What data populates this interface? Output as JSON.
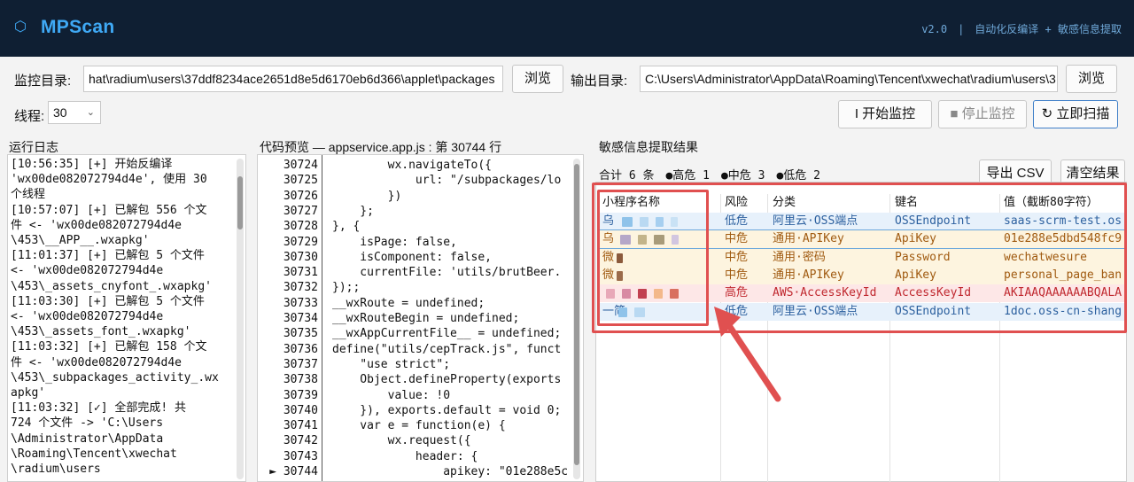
{
  "header": {
    "logo_glyph": "⬡",
    "title": "MPScan",
    "version": "v2.0　|　自动化反编译 + 敏感信息提取"
  },
  "toolbar": {
    "monitor_dir_label": "监控目录:",
    "monitor_dir_value": "hat\\radium\\users\\37ddf8234ace2651d8e5d6170eb6d366\\applet\\packages",
    "browse_label_1": "浏览",
    "output_dir_label": "输出目录:",
    "output_dir_value": "C:\\Users\\Administrator\\AppData\\Roaming\\Tencent\\xwechat\\radium\\users\\3",
    "browse_label_2": "浏览",
    "threads_label": "线程:",
    "threads_value": "30",
    "start_label": "I 开始监控",
    "stop_label": "■ 停止监控",
    "scan_label": "↻ 立即扫描"
  },
  "log": {
    "title": "运行日志",
    "lines": [
      "[10:56:35] [+] 开始反编译",
      "'wx00de082072794d4e', 使用 30",
      "个线程",
      "[10:57:07] [+] 已解包 556 个文",
      "件 <- 'wx00de082072794d4e",
      "\\453\\__APP__.wxapkg'",
      "[11:01:37] [+] 已解包 5 个文件",
      "<- 'wx00de082072794d4e",
      "\\453\\_assets_cnyfont_.wxapkg'",
      "[11:03:30] [+] 已解包 5 个文件",
      "<- 'wx00de082072794d4e",
      "\\453\\_assets_font_.wxapkg'",
      "[11:03:32] [+] 已解包 158 个文",
      "件 <- 'wx00de082072794d4e",
      "\\453\\_subpackages_activity_.wx",
      "apkg'",
      "[11:03:32] [✓] 全部完成! 共",
      "724 个文件 -> 'C:\\Users",
      "\\Administrator\\AppData",
      "\\Roaming\\Tencent\\xwechat",
      "\\radium\\users"
    ]
  },
  "code": {
    "title": "代码预览 — appservice.app.js : 第 30744 行",
    "numbers": [
      "30724",
      "30725",
      "30726",
      "30727",
      "30728",
      "30729",
      "30730",
      "30731",
      "30732",
      "30733",
      "30734",
      "30735",
      "30736",
      "30737",
      "30738",
      "30739",
      "30740",
      "30741",
      "30742",
      "30743",
      "► 30744"
    ],
    "lines": [
      "        wx.navigateTo({",
      "            url: \"/subpackages/lo",
      "        })",
      "    };",
      "}, {",
      "    isPage: false,",
      "    isComponent: false,",
      "    currentFile: 'utils/brutBeer.",
      "});;",
      "__wxRoute = undefined;",
      "__wxRouteBegin = undefined;",
      "__wxAppCurrentFile__ = undefined;",
      "define(\"utils/cepTrack.js\", funct",
      "    \"use strict\";",
      "    Object.defineProperty(exports",
      "        value: !0",
      "    }), exports.default = void 0;",
      "    var e = function(e) {",
      "        wx.request({",
      "            header: {",
      "                apikey: \"01e288e5c"
    ]
  },
  "results": {
    "title": "敏感信息提取结果",
    "stats": "合计 6 条　●高危 1　●中危 3　●低危 2",
    "export_label": "导出 CSV",
    "clear_label": "清空结果",
    "columns": [
      "小程序名称",
      "风险",
      "分类",
      "键名",
      "值（截断80字符）"
    ],
    "rows": [
      {
        "app": "乌",
        "risk": "低危",
        "category": "阿里云·OSS端点",
        "key": "OSSEndpoint",
        "value": "saas-scrm-test.os"
      },
      {
        "app": "乌",
        "risk": "中危",
        "category": "通用·APIKey",
        "key": "ApiKey",
        "value": "01e288e5dbd548fc9"
      },
      {
        "app": "微",
        "risk": "中危",
        "category": "通用·密码",
        "key": "Password",
        "value": "wechatwesure"
      },
      {
        "app": "微",
        "risk": "中危",
        "category": "通用·APIKey",
        "key": "ApiKey",
        "value": "personal_page_ban"
      },
      {
        "app": "",
        "risk": "高危",
        "category": "AWS·AccessKeyId",
        "key": "AccessKeyId",
        "value": "AKIAAQAAAAAABQALA"
      },
      {
        "app": "一简",
        "risk": "低危",
        "category": "阿里云·OSS端点",
        "key": "OSSEndpoint",
        "value": "1doc.oss-cn-shang"
      }
    ]
  },
  "colors": {
    "header_bg": "#0f1f33",
    "accent": "#3fa9f5",
    "low_row": "#e7f1fb",
    "mid_row": "#fdf4df",
    "high_row": "#fde7e7",
    "low_text": "#2b5f9e",
    "mid_text": "#a05a10",
    "high_text": "#c0282f",
    "annotation_red": "#e05050"
  }
}
